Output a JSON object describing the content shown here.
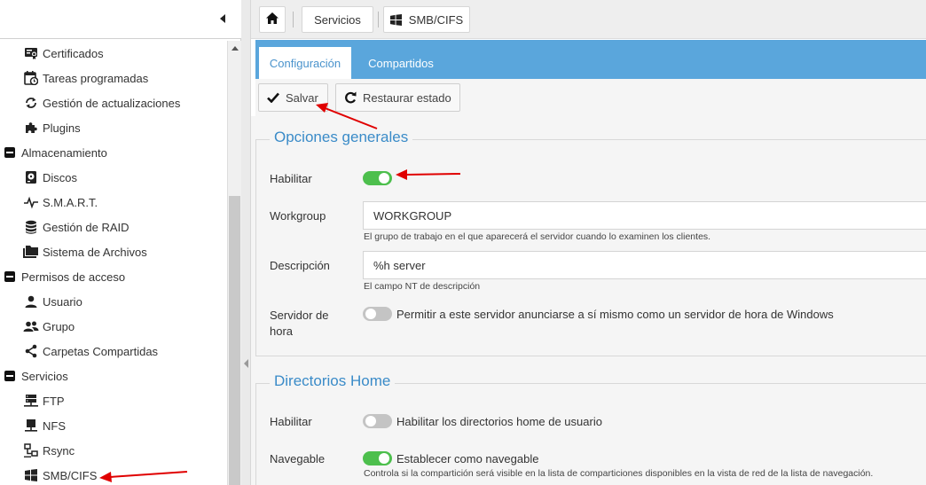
{
  "sidebar": {
    "items": [
      {
        "label": "Certificados",
        "icon": "certificate-icon",
        "type": "child"
      },
      {
        "label": "Tareas programadas",
        "icon": "calendar-clock-icon",
        "type": "child"
      },
      {
        "label": "Gestión de actualizaciones",
        "icon": "refresh-icon",
        "type": "child"
      },
      {
        "label": "Plugins",
        "icon": "puzzle-icon",
        "type": "child"
      },
      {
        "label": "Almacenamiento",
        "icon": "minus-box-icon",
        "type": "group"
      },
      {
        "label": "Discos",
        "icon": "harddisk-icon",
        "type": "child"
      },
      {
        "label": "S.M.A.R.T.",
        "icon": "pulse-icon",
        "type": "child"
      },
      {
        "label": "Gestión de RAID",
        "icon": "database-icon",
        "type": "child"
      },
      {
        "label": "Sistema de Archivos",
        "icon": "folders-icon",
        "type": "child"
      },
      {
        "label": "Permisos de acceso",
        "icon": "minus-box-icon",
        "type": "group"
      },
      {
        "label": "Usuario",
        "icon": "user-icon",
        "type": "child"
      },
      {
        "label": "Grupo",
        "icon": "group-icon",
        "type": "child"
      },
      {
        "label": "Carpetas Compartidas",
        "icon": "share-icon",
        "type": "child"
      },
      {
        "label": "Servicios",
        "icon": "minus-box-icon",
        "type": "group"
      },
      {
        "label": "FTP",
        "icon": "server-network-icon",
        "type": "child"
      },
      {
        "label": "NFS",
        "icon": "desktop-icon",
        "type": "child"
      },
      {
        "label": "Rsync",
        "icon": "sync-network-icon",
        "type": "child"
      },
      {
        "label": "SMB/CIFS",
        "icon": "windows-icon",
        "type": "child"
      }
    ]
  },
  "breadcrumb": {
    "home_icon": "home-icon",
    "servicios": "Servicios",
    "smb": "SMB/CIFS"
  },
  "tabs": {
    "config": "Configuración",
    "compartidos": "Compartidos"
  },
  "toolbar": {
    "save": "Salvar",
    "restore": "Restaurar estado"
  },
  "general": {
    "legend": "Opciones generales",
    "enable_label": "Habilitar",
    "enable_on": true,
    "workgroup_label": "Workgroup",
    "workgroup_value": "WORKGROUP",
    "workgroup_hint": "El grupo de trabajo en el que aparecerá el servidor cuando lo examinen los clientes.",
    "desc_label": "Descripción",
    "desc_value": "%h server",
    "desc_hint": "El campo NT de descripción",
    "time_label_1": "Servidor de",
    "time_label_2": "hora",
    "time_on": false,
    "time_text": "Permitir a este servidor anunciarse a sí mismo como un servidor de hora de Windows"
  },
  "home": {
    "legend": "Directorios Home",
    "enable_label": "Habilitar",
    "enable_on": false,
    "enable_text": "Habilitar los directorios home de usuario",
    "browse_label": "Navegable",
    "browse_on": true,
    "browse_text": "Establecer como navegable",
    "browse_hint": "Controla si la compartición será visible en la lista de comparticiones disponibles en la vista de red de la lista de navegación."
  },
  "colors": {
    "accent": "#5aa6dc",
    "switch_on": "#4dbf4d",
    "annotation_arrow": "#e00000"
  }
}
